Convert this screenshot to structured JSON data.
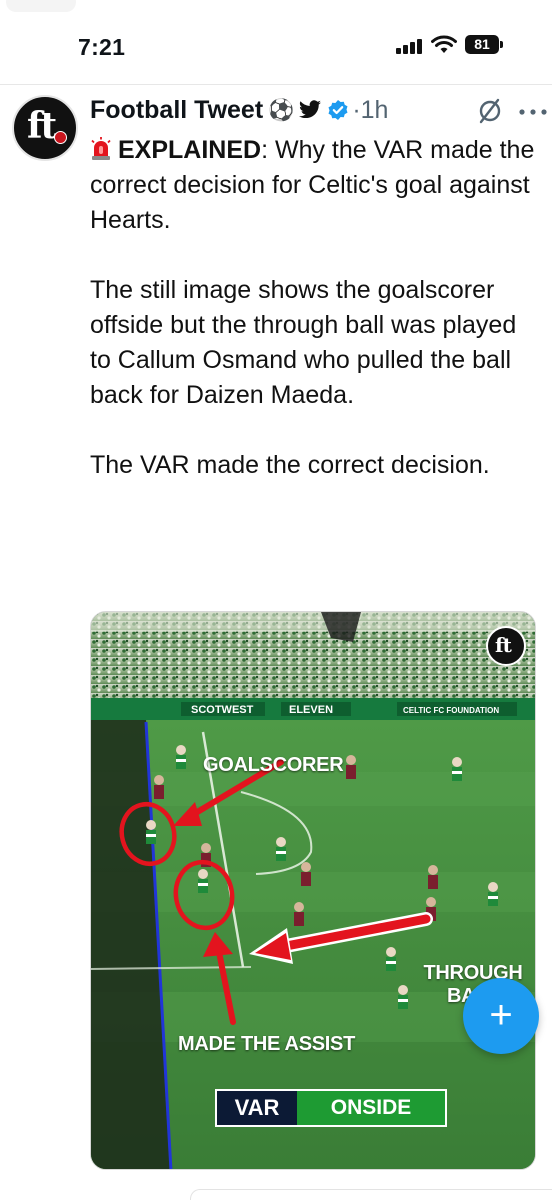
{
  "status_bar": {
    "time": "7:21",
    "battery": "81"
  },
  "tweet": {
    "author_name": "Football Tweet",
    "author_emojis": "⚽",
    "timestamp": "1h",
    "headline_bold": "EXPLAINED",
    "headline_rest": ": Why the VAR made the correct decision for Celtic's goal against Hearts.",
    "paragraph_2": "The still image shows the goalscorer offside but the through ball was played to Callum Osmand who pulled the ball back for Daizen Maeda.",
    "paragraph_3": "The VAR made the correct decision."
  },
  "media": {
    "label_goalscorer": "GOALSCORER",
    "label_through_line1": "THROUGH",
    "label_through_line2": "BALL",
    "label_assist": "MADE THE ASSIST",
    "var_left": "VAR",
    "var_right": "ONSIDE",
    "logo": "ft",
    "board_text_1": "SCOTWEST",
    "board_text_2": "ELEVEN",
    "board_text_3": "CELTIC FC FOUNDATION"
  },
  "avatar_text": "ft",
  "compose_button": "+",
  "colors": {
    "accent": "#1d9bf0",
    "verified": "#1d9bf0",
    "arrow_red": "#e3141e",
    "onside_green": "#1e9b33",
    "var_navy": "#0c1a35"
  },
  "icons": [
    "signal-icon",
    "wifi-icon",
    "battery-icon",
    "soccer-ball-icon",
    "bird-icon",
    "verified-badge-icon",
    "grok-icon",
    "more-icon",
    "siren-icon",
    "compose-plus-icon"
  ]
}
